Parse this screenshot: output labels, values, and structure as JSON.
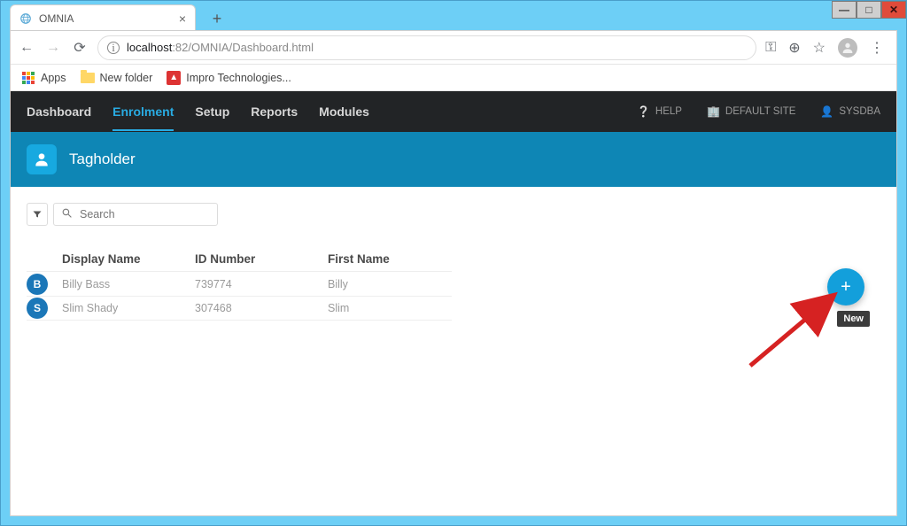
{
  "window": {
    "min": "—",
    "max": "□",
    "close": "✕"
  },
  "browser": {
    "tab_title": "OMNIA",
    "new_tab": "+",
    "url_host": "localhost",
    "url_port_path": ":82/OMNIA/Dashboard.html",
    "bookmarks": {
      "apps": "Apps",
      "newfolder": "New folder",
      "impro": "Impro Technologies..."
    }
  },
  "nav": {
    "items": [
      "Dashboard",
      "Enrolment",
      "Setup",
      "Reports",
      "Modules"
    ],
    "active_index": 1,
    "help": "HELP",
    "site": "DEFAULT SITE",
    "user": "SYSDBA"
  },
  "hero": {
    "title": "Tagholder"
  },
  "search": {
    "placeholder": "Search"
  },
  "table": {
    "headers": {
      "display_name": "Display Name",
      "id_number": "ID Number",
      "first_name": "First Name"
    },
    "rows": [
      {
        "initial": "B",
        "display_name": "Billy Bass",
        "id_number": "739774",
        "first_name": "Billy"
      },
      {
        "initial": "S",
        "display_name": "Slim Shady",
        "id_number": "307468",
        "first_name": "Slim"
      }
    ]
  },
  "fab": {
    "tooltip": "New",
    "glyph": "+"
  }
}
